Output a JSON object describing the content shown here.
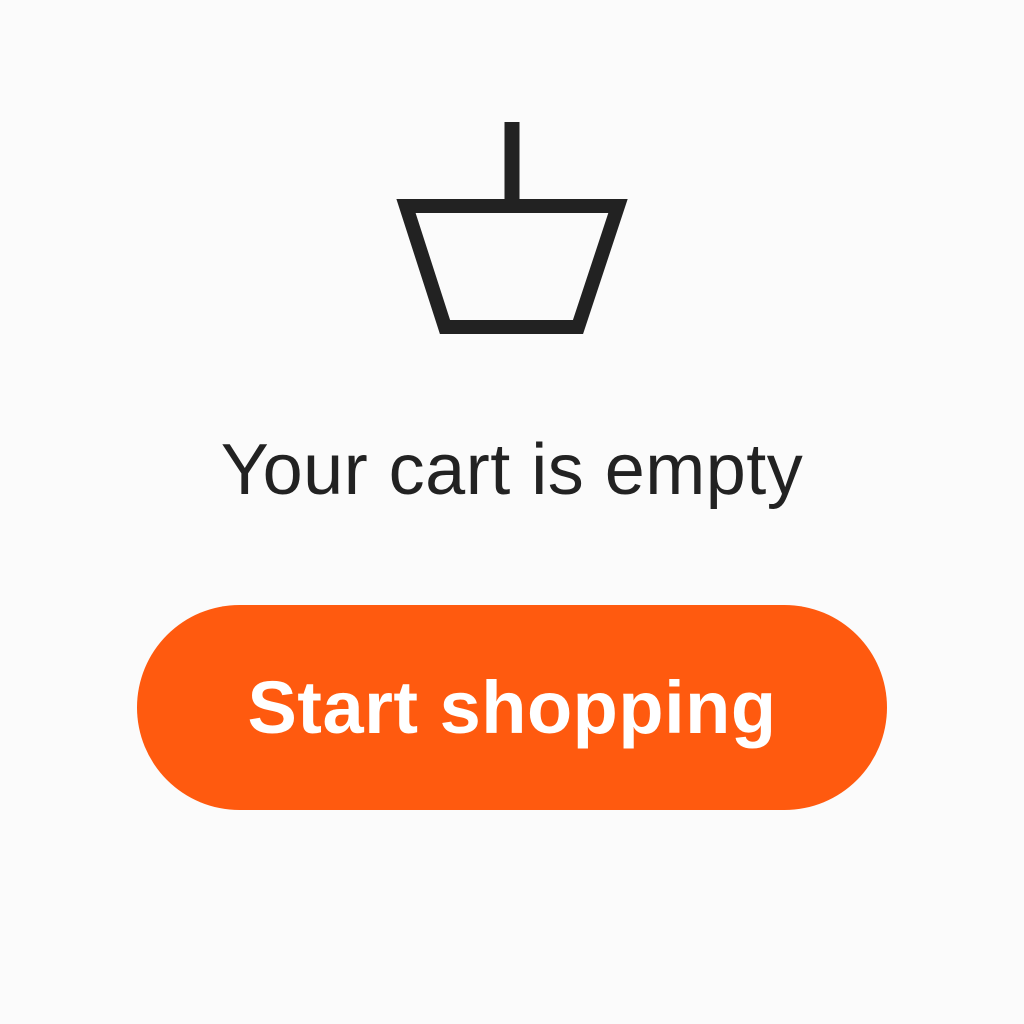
{
  "empty_state": {
    "icon": "basket-icon",
    "message": "Your cart is empty",
    "button_label": "Start shopping"
  },
  "colors": {
    "background": "#fbfbfb",
    "text": "#222222",
    "icon": "#222222",
    "accent": "#ff5a0f",
    "button_text": "#ffffff"
  }
}
